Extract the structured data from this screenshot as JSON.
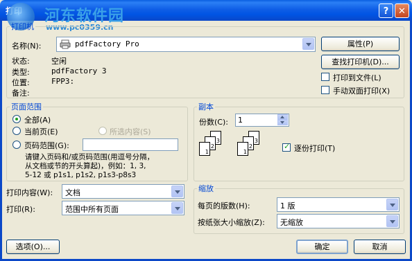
{
  "window": {
    "title": "打印",
    "help_label": "?",
    "close_label": "✕"
  },
  "watermark": {
    "text": "河东软件园",
    "url": "www.pc0359.cn"
  },
  "printer": {
    "group_label": "打印机",
    "name_label": "名称(N):",
    "name_value": "pdfFactory Pro",
    "status_label": "状态:",
    "status_value": "空闲",
    "type_label": "类型:",
    "type_value": "pdfFactory 3",
    "where_label": "位置:",
    "where_value": "FPP3:",
    "comment_label": "备注:",
    "comment_value": "",
    "properties_button": "属性(P)",
    "find_printer_button": "查找打印机(D)...",
    "print_to_file": {
      "label": "打印到文件(L)",
      "checked": false
    },
    "manual_duplex": {
      "label": "手动双面打印(X)",
      "checked": false
    }
  },
  "page_range": {
    "group_label": "页面范围",
    "all": {
      "label": "全部(A)",
      "selected": true
    },
    "current": {
      "label": "当前页(E)",
      "selected": false
    },
    "selection": {
      "label": "所选内容(S)",
      "selected": false,
      "disabled": true
    },
    "pages": {
      "label": "页码范围(G):",
      "selected": false,
      "value": ""
    },
    "hint": [
      "请键入页码和/或页码范围(用逗号分隔，",
      "从文档或节的开头算起)，例如：1, 3,",
      "5-12 或 p1s1, p1s2, p1s3-p8s3"
    ]
  },
  "copies": {
    "group_label": "副本",
    "count_label": "份数(C):",
    "count_value": "1",
    "collate": {
      "label": "逐份打印(T)",
      "checked": true
    },
    "stack_a": [
      "1",
      "2",
      "3"
    ],
    "stack_b": [
      "1",
      "2",
      "3"
    ]
  },
  "print_what": {
    "label": "打印内容(W):",
    "value": "文档"
  },
  "print": {
    "label": "打印(R):",
    "value": "范围中所有页面"
  },
  "zoom": {
    "group_label": "缩放",
    "pages_per_sheet_label": "每页的版数(H):",
    "pages_per_sheet_value": "1 版",
    "scale_label": "按纸张大小缩放(Z):",
    "scale_value": "无缩放"
  },
  "buttons": {
    "options": "选项(O)...",
    "ok": "确定",
    "cancel": "取消"
  }
}
